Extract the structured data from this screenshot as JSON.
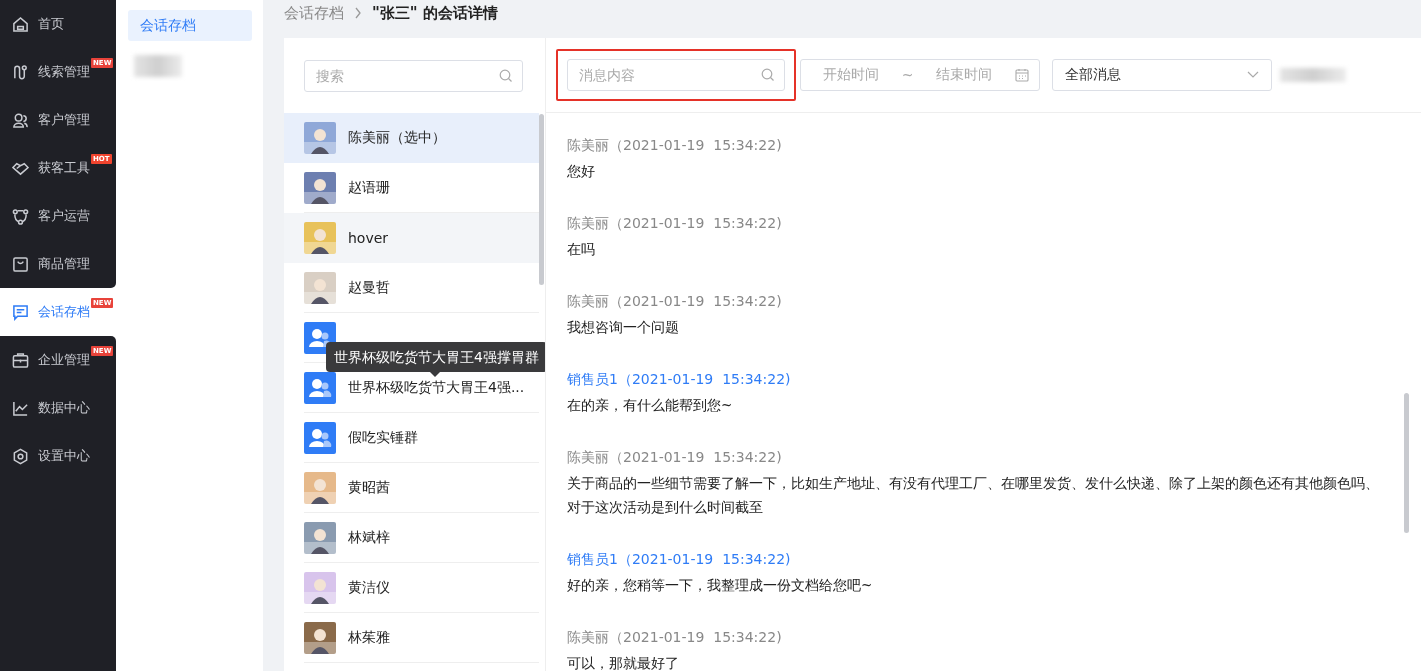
{
  "nav": {
    "items": [
      {
        "label": "首页",
        "selected": false
      },
      {
        "label": "线索管理",
        "selected": false,
        "badge": "NEW"
      },
      {
        "label": "客户管理",
        "selected": false
      },
      {
        "label": "获客工具",
        "selected": false,
        "badge": "HOT"
      },
      {
        "label": "客户运营",
        "selected": false
      },
      {
        "label": "商品管理",
        "selected": false
      },
      {
        "label": "会话存档",
        "selected": true,
        "badge": "NEW"
      },
      {
        "label": "企业管理",
        "selected": false,
        "badge": "NEW"
      },
      {
        "label": "数据中心",
        "selected": false
      },
      {
        "label": "设置中心",
        "selected": false
      }
    ]
  },
  "submenu": {
    "items": [
      {
        "label": "会话存档",
        "selected": true
      }
    ]
  },
  "breadcrumb": {
    "parent": "会话存档",
    "current": "\"张三\" 的会话详情"
  },
  "contacts": {
    "search": {
      "placeholder": "搜索"
    },
    "items": [
      {
        "name": "陈美丽（选中）",
        "color": "#8fa8d8",
        "selected": true,
        "hovered": false
      },
      {
        "name": "赵语珊",
        "color": "#6d7fb0",
        "selected": false,
        "hovered": false
      },
      {
        "name": "hover",
        "color": "#e8c25a",
        "selected": false,
        "hovered": true
      },
      {
        "name": "赵曼哲",
        "color": "#d9cfc4",
        "selected": false,
        "hovered": false
      },
      {
        "kind": "group",
        "selected": false,
        "hovered": false
      },
      {
        "name": "世界杯级吃货节大胃王4强...",
        "kind": "group",
        "selected": false,
        "hovered": false,
        "tooltip": "世界杯级吃货节大胃王4强撑胃群"
      },
      {
        "name": "假吃实锤群",
        "kind": "group",
        "selected": false,
        "hovered": false
      },
      {
        "name": "黄昭茜",
        "color": "#e6b98a",
        "selected": false,
        "hovered": false
      },
      {
        "name": "林斌梓",
        "color": "#8a9bb0",
        "selected": false,
        "hovered": false
      },
      {
        "name": "黄洁仪",
        "color": "#d8c4ec",
        "selected": false,
        "hovered": false
      },
      {
        "name": "林茱雅",
        "color": "#8a6a4a",
        "selected": false,
        "hovered": false
      }
    ]
  },
  "filters": {
    "message_search": {
      "placeholder": "消息内容",
      "highlighted": true
    },
    "date_range": {
      "start_placeholder": "开始时间",
      "separator": "~",
      "end_placeholder": "结束时间"
    },
    "type_select": {
      "value": "全部消息"
    }
  },
  "messages": [
    {
      "kind": "customer",
      "header": "陈美丽（2021-01-19  15:34:22)",
      "text": "您好"
    },
    {
      "kind": "customer",
      "header": "陈美丽（2021-01-19  15:34:22)",
      "text": "在吗"
    },
    {
      "kind": "customer",
      "header": "陈美丽（2021-01-19  15:34:22)",
      "text": "我想咨询一个问题"
    },
    {
      "kind": "sales",
      "header": "销售员1（2021-01-19  15:34:22)",
      "text": "在的亲，有什么能帮到您~"
    },
    {
      "kind": "customer",
      "header": "陈美丽（2021-01-19  15:34:22)",
      "text": "关于商品的一些细节需要了解一下，比如生产地址、有没有代理工厂、在哪里发货、发什么快递、除了上架的颜色还有其他颜色吗、对于这次活动是到什么时间截至"
    },
    {
      "kind": "sales",
      "header": "销售员1（2021-01-19  15:34:22)",
      "text": "好的亲，您稍等一下，我整理成一份文档给您吧~"
    },
    {
      "kind": "customer",
      "header": "陈美丽（2021-01-19  15:34:22)",
      "text": "可以，那就最好了"
    }
  ]
}
